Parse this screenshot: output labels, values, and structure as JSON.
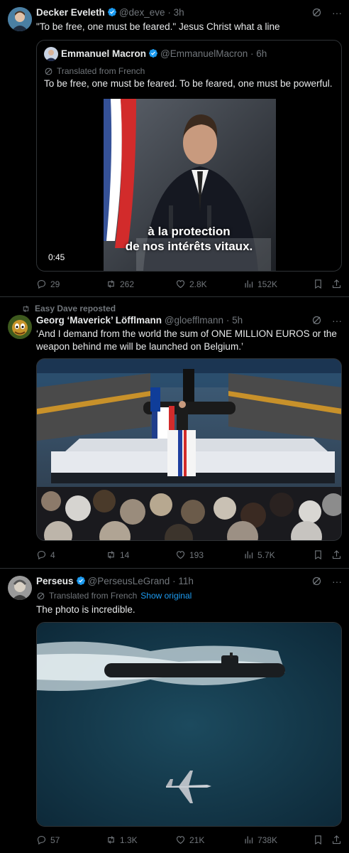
{
  "tweets": [
    {
      "name": "Decker Eveleth",
      "handle": "@dex_eve",
      "time": "3h",
      "text": "\"To be free, one must be feared.\" Jesus Christ what a line",
      "quote": {
        "name": "Emmanuel Macron",
        "handle": "@EmmanuelMacron",
        "time": "6h",
        "translated_label": "Translated from French",
        "text": "To be free, one must be feared. To be feared, one must be powerful.",
        "video_caption_line1": "à la protection",
        "video_caption_line2": "de nos intérêts vitaux.",
        "video_duration": "0:45"
      },
      "stats": {
        "replies": "29",
        "reposts": "262",
        "likes": "2.8K",
        "views": "152K"
      }
    },
    {
      "social_context": "Easy Dave reposted",
      "name": "Georg ‘Maverick’ Löfflmann",
      "handle": "@gloefflmann",
      "time": "5h",
      "text": "‘And I demand from the world the sum of ONE MILLION EUROS or the weapon behind me will be launched on Belgium.’",
      "stats": {
        "replies": "4",
        "reposts": "14",
        "likes": "193",
        "views": "5.7K"
      }
    },
    {
      "name": "Perseus",
      "handle": "@PerseusLeGrand",
      "time": "11h",
      "translated_label": "Translated from French",
      "show_original": "Show original",
      "text": "The photo is incredible.",
      "stats": {
        "replies": "57",
        "reposts": "1.3K",
        "likes": "21K",
        "views": "738K"
      }
    }
  ],
  "colors": {
    "background": "#000000",
    "text": "#e7e9ea",
    "muted": "#71767b",
    "verified": "#1d9bf0",
    "border": "#2f3336"
  }
}
